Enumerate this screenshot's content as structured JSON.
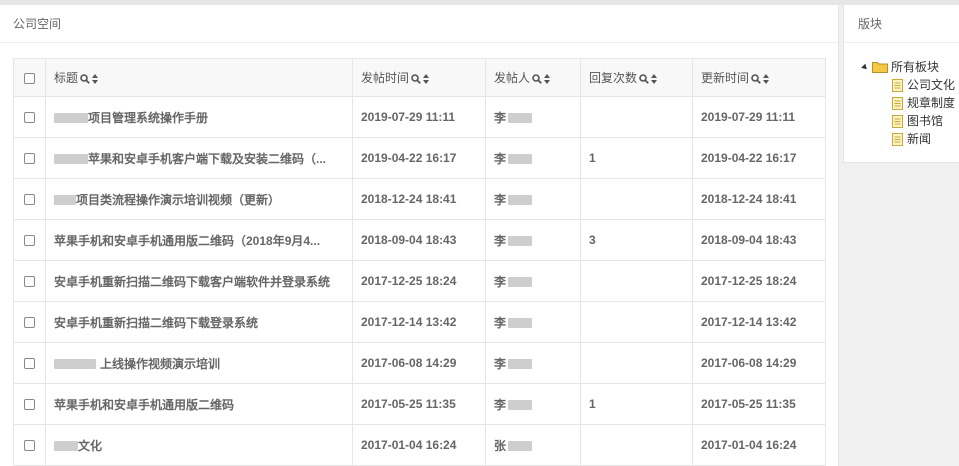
{
  "main": {
    "title": "公司空间",
    "columns": {
      "title": "标题",
      "post_time": "发帖时间",
      "poster": "发帖人",
      "reply_count": "回复次数",
      "update_time": "更新时间"
    },
    "rows": [
      {
        "title": "项目管理系统操作手册",
        "post_time": "2019-07-29 11:11",
        "poster": "李",
        "replies": "",
        "update_time": "2019-07-29 11:11"
      },
      {
        "title": "苹果和安卓手机客户端下载及安装二维码（...",
        "post_time": "2019-04-22 16:17",
        "poster": "李",
        "replies": "1",
        "update_time": "2019-04-22 16:17"
      },
      {
        "title": "项目类流程操作演示培训视频（更新）",
        "post_time": "2018-12-24 18:41",
        "poster": "李",
        "replies": "",
        "update_time": "2018-12-24 18:41"
      },
      {
        "title": "苹果手机和安卓手机通用版二维码（2018年9月4...",
        "post_time": "2018-09-04 18:43",
        "poster": "李",
        "replies": "3",
        "update_time": "2018-09-04 18:43"
      },
      {
        "title": "安卓手机重新扫描二维码下载客户端软件并登录系统",
        "post_time": "2017-12-25 18:24",
        "poster": "李",
        "replies": "",
        "update_time": "2017-12-25 18:24"
      },
      {
        "title": "安卓手机重新扫描二维码下载登录系统",
        "post_time": "2017-12-14 13:42",
        "poster": "李",
        "replies": "",
        "update_time": "2017-12-14 13:42"
      },
      {
        "title": "上线操作视频演示培训",
        "post_time": "2017-06-08 14:29",
        "poster": "李",
        "replies": "",
        "update_time": "2017-06-08 14:29"
      },
      {
        "title": "苹果手机和安卓手机通用版二维码",
        "post_time": "2017-05-25 11:35",
        "poster": "李",
        "replies": "1",
        "update_time": "2017-05-25 11:35"
      },
      {
        "title": "文化",
        "post_time": "2017-01-04 16:24",
        "poster": "张",
        "replies": "",
        "update_time": "2017-01-04 16:24"
      }
    ]
  },
  "side": {
    "title": "版块",
    "root": "所有板块",
    "children": [
      "公司文化",
      "规章制度",
      "图书馆",
      "新闻"
    ]
  },
  "colors": {
    "folder": "#f3c843",
    "doc_fill": "#fbf3c2",
    "doc_border": "#c9a93a"
  },
  "icons": {
    "search": "search-icon",
    "sort": "sort-icon",
    "folder": "folder-icon",
    "doc": "document-icon"
  }
}
